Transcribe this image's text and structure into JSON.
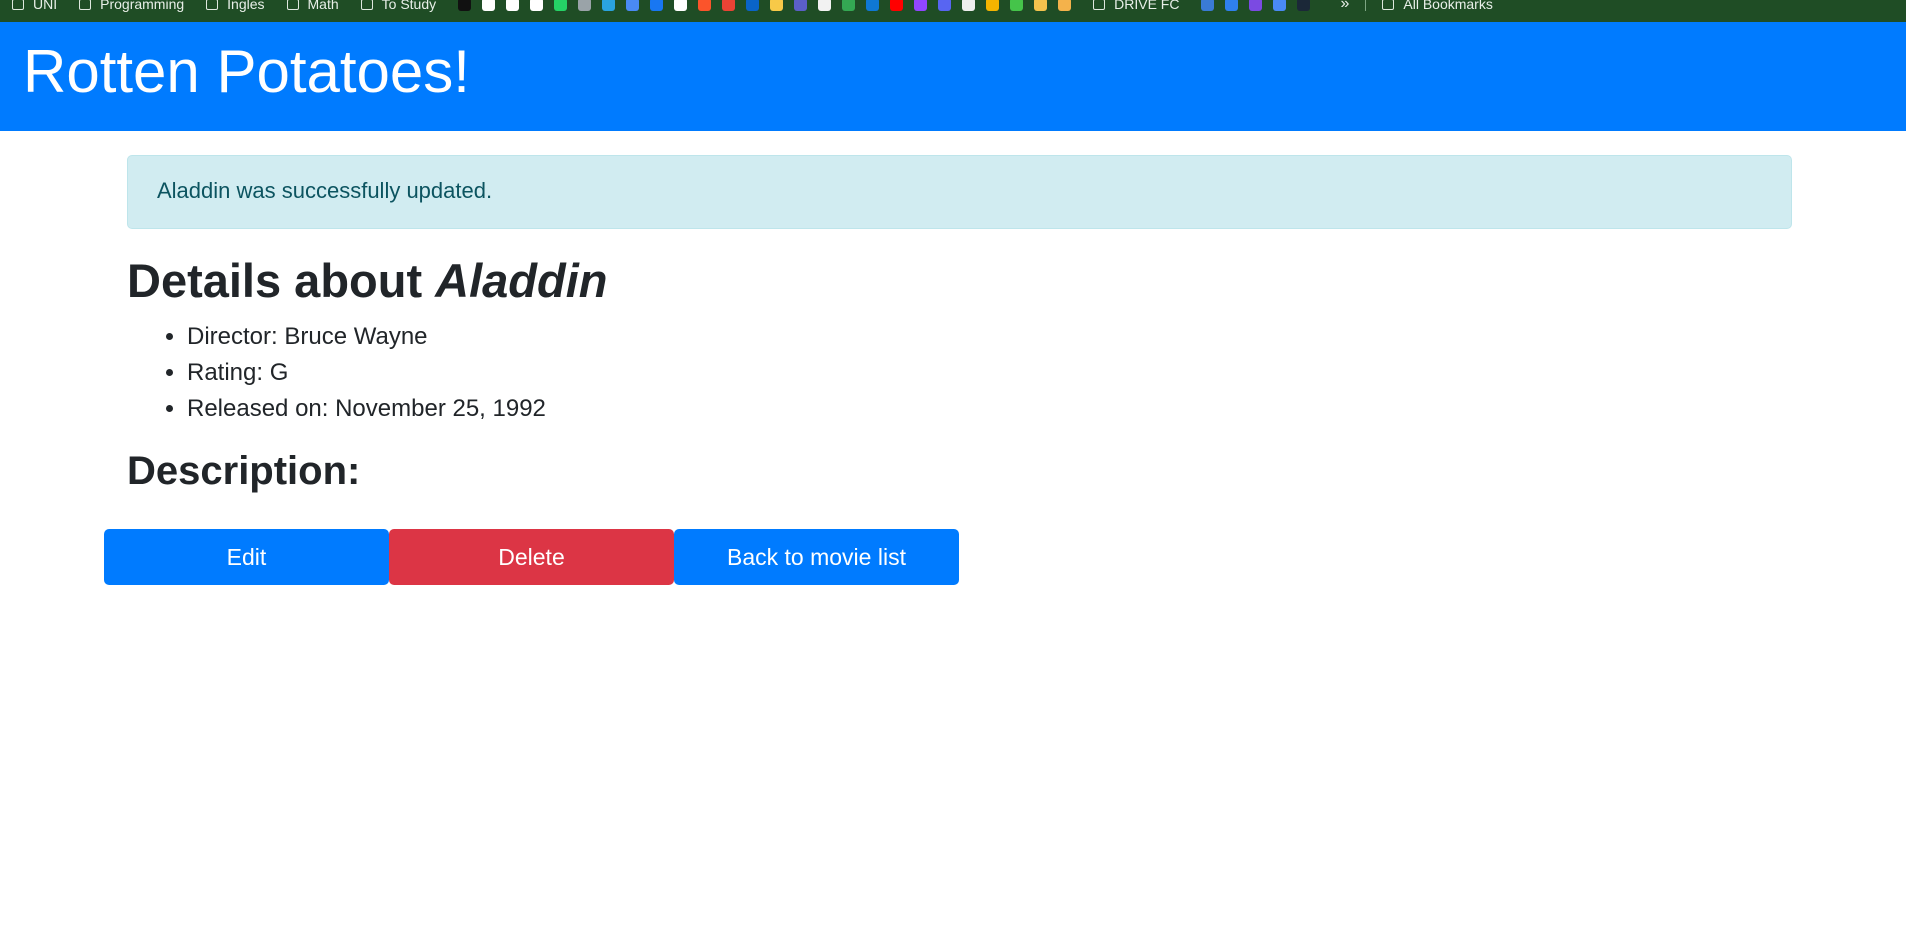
{
  "bookmarks_bar": {
    "folders_left": [
      "UNI",
      "Programming",
      "Ingles",
      "Math",
      "To Study"
    ],
    "favicon_icons": [
      {
        "name": "openai-icon",
        "color": "#111111"
      },
      {
        "name": "yc-icon",
        "color": "#ffffff"
      },
      {
        "name": "doc-icon",
        "color": "#ffffff"
      },
      {
        "name": "chess-icon",
        "color": "#ffffff"
      },
      {
        "name": "whatsapp-icon",
        "color": "#25d366"
      },
      {
        "name": "chatbot-icon",
        "color": "#9aa3a8"
      },
      {
        "name": "telegram-icon",
        "color": "#2aa3df"
      },
      {
        "name": "translate-icon",
        "color": "#4a8af4"
      },
      {
        "name": "facebook-icon",
        "color": "#1877f2"
      },
      {
        "name": "github-icon",
        "color": "#ffffff"
      },
      {
        "name": "brave-icon",
        "color": "#fb542b"
      },
      {
        "name": "gmail-icon",
        "color": "#ea4335"
      },
      {
        "name": "outlook-icon",
        "color": "#0a64c8"
      },
      {
        "name": "photos-icon",
        "color": "#f7c948"
      },
      {
        "name": "teams-icon",
        "color": "#5b5fc7"
      },
      {
        "name": "calendar-icon",
        "color": "#f2f2f2"
      },
      {
        "name": "drive-icon",
        "color": "#34a853"
      },
      {
        "name": "onedrive-icon",
        "color": "#0f78d4"
      },
      {
        "name": "youtube-icon",
        "color": "#ff0000"
      },
      {
        "name": "twitch-icon",
        "color": "#9146ff"
      },
      {
        "name": "discord-icon",
        "color": "#5865f2"
      },
      {
        "name": "app-icon",
        "color": "#eeeeee"
      },
      {
        "name": "sheets-icon",
        "color": "#f4b400"
      },
      {
        "name": "ai-icon",
        "color": "#45c44a"
      },
      {
        "name": "avatar-icon",
        "color": "#f3c34d"
      },
      {
        "name": "hourglass-icon",
        "color": "#f4b24b"
      }
    ],
    "folders_right": [
      "DRIVE FC"
    ],
    "favicon_icons_right": [
      {
        "name": "copilot-icon",
        "color": "#3a7bd5"
      },
      {
        "name": "vscode-icon",
        "color": "#2f80ed"
      },
      {
        "name": "university-icon",
        "color": "#7b4ae2"
      },
      {
        "name": "board-icon",
        "color": "#4a8af4"
      },
      {
        "name": "steam-icon",
        "color": "#1b2838"
      }
    ],
    "overflow_chevron": "»",
    "all_bookmarks": "All Bookmarks"
  },
  "header": {
    "title": "Rotten Potatoes!"
  },
  "flash": {
    "message": "Aladdin was successfully updated."
  },
  "movie": {
    "details_prefix": "Details about ",
    "title": "Aladdin",
    "facts": [
      "Director: Bruce Wayne",
      "Rating: G",
      "Released on: November 25, 1992"
    ],
    "description_heading": "Description:"
  },
  "actions": {
    "edit_label": "Edit",
    "delete_label": "Delete",
    "back_label": "Back to movie list"
  },
  "colors": {
    "header_bg": "#007bff",
    "flash_bg": "#d1ecf1",
    "flash_text": "#0c5460",
    "primary": "#007bff",
    "danger": "#dc3545",
    "bookmarks_bg": "#1f4d25"
  }
}
